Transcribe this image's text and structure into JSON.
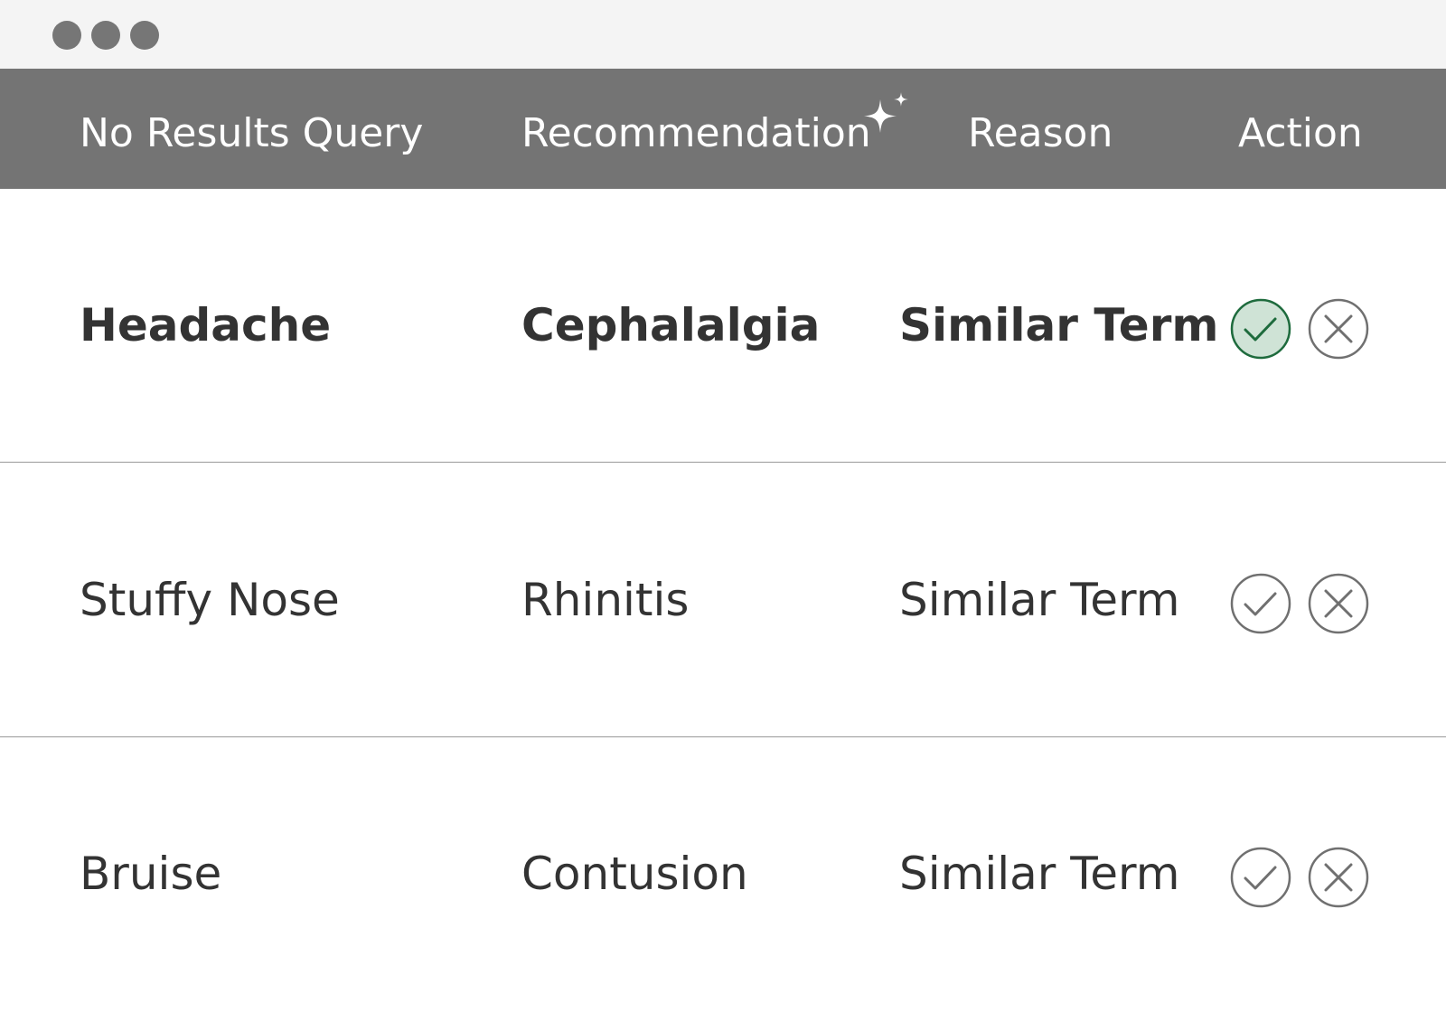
{
  "header": {
    "query_label": "No Results Query",
    "recommendation_label": "Recommendation",
    "reason_label": "Reason",
    "action_label": "Action",
    "recommendation_icon": "sparkle-icon"
  },
  "rows": [
    {
      "query": "Headache",
      "recommendation": "Cephalalgia",
      "reason": "Similar Term",
      "accepted": true
    },
    {
      "query": "Stuffy Nose",
      "recommendation": "Rhinitis",
      "reason": "Similar Term",
      "accepted": false
    },
    {
      "query": "Bruise",
      "recommendation": "Contusion",
      "reason": "Similar Term",
      "accepted": false
    }
  ],
  "icons": {
    "accept": "check-circle-icon",
    "reject": "x-circle-icon"
  },
  "colors": {
    "header_bg": "#747474",
    "accept_active_stroke": "#1e6b3d",
    "accept_active_fill": "#cfe3d6",
    "inactive_stroke": "#707070",
    "text": "#333333"
  }
}
